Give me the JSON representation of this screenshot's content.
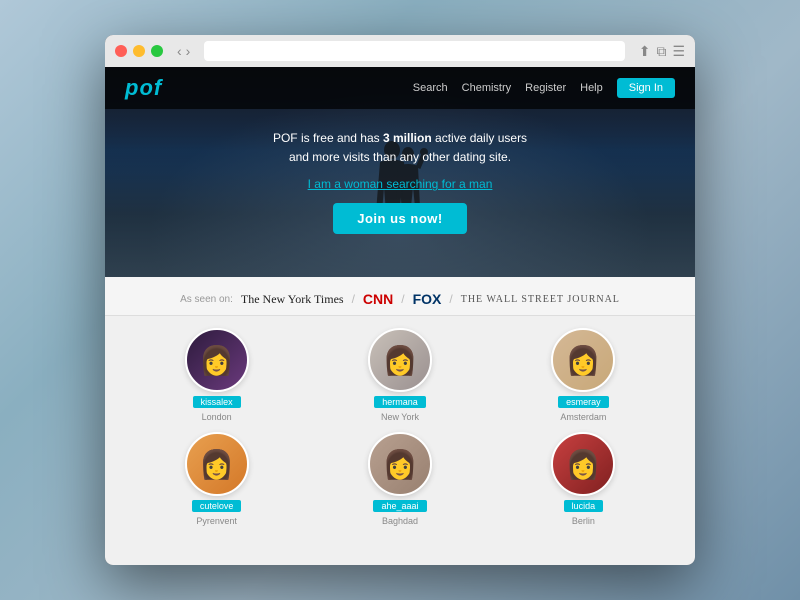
{
  "browser": {
    "dots": [
      "red",
      "yellow",
      "green"
    ],
    "nav_back": "‹",
    "nav_forward": "›"
  },
  "navbar": {
    "logo": "pof",
    "links": [
      "Search",
      "Chemistry",
      "Register",
      "Help"
    ],
    "sign_in": "Sign In"
  },
  "hero": {
    "tagline_line1": "POF is free and has ",
    "tagline_bold": "3 million",
    "tagline_line2": " active daily users",
    "tagline_line3": "and more visits than any other dating site.",
    "search_prefix": "I am a ",
    "search_gender": "woman",
    "search_middle": " searching for a ",
    "search_target": "man",
    "join_button": "Join us now!"
  },
  "press": {
    "label": "As seen on:",
    "outlets": [
      {
        "name": "The New York Times",
        "class": "nyt"
      },
      {
        "sep": "/"
      },
      {
        "name": "CNN",
        "class": "cnn"
      },
      {
        "sep": "/"
      },
      {
        "name": "FOX",
        "class": "fox"
      },
      {
        "sep": "/"
      },
      {
        "name": "THE WALL STREET JOURNAL",
        "class": "wsj"
      }
    ]
  },
  "profiles": {
    "row1": [
      {
        "name": "kissalex",
        "city": "London",
        "avatar_class": "p1"
      },
      {
        "name": "hermana",
        "city": "New York",
        "avatar_class": "p2"
      },
      {
        "name": "esmeray",
        "city": "Amsterdam",
        "avatar_class": "p3"
      }
    ],
    "row2": [
      {
        "name": "cutelove",
        "city": "Pyrenvent",
        "avatar_class": "p4"
      },
      {
        "name": "ahe_aaai",
        "city": "Baghdad",
        "avatar_class": "p5"
      },
      {
        "name": "lucida",
        "city": "Berlin",
        "avatar_class": "p6"
      }
    ]
  },
  "colors": {
    "accent": "#00bcd4",
    "hero_bg": "#1a1a2e",
    "press_bg": "#f5f5f5"
  }
}
